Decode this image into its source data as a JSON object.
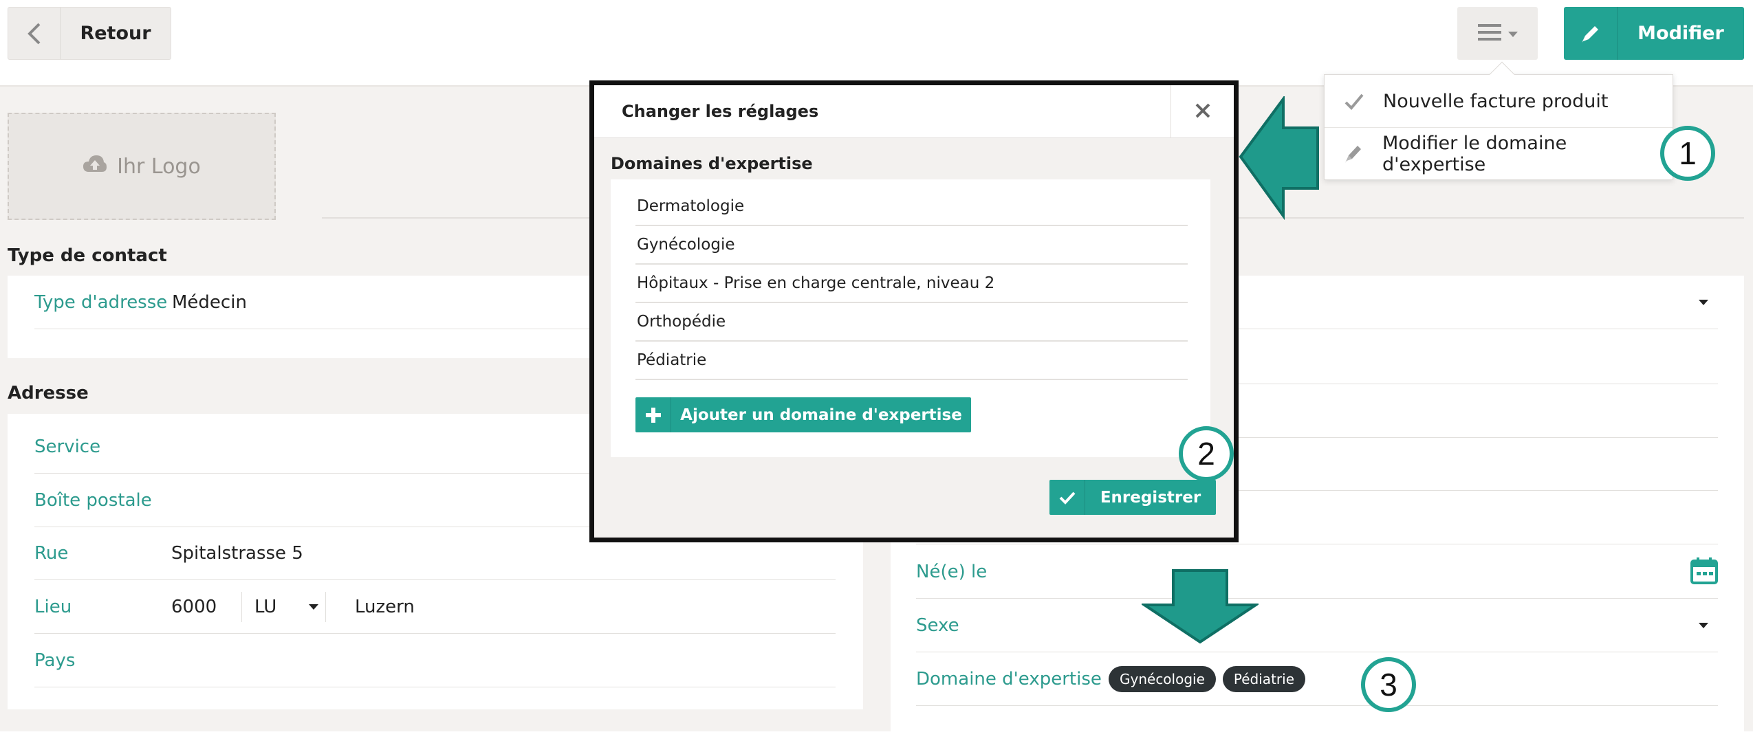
{
  "toolbar": {
    "back_label": "Retour",
    "edit_label": "Modifier"
  },
  "menu": {
    "items": [
      {
        "label": "Nouvelle facture produit",
        "icon": "check-icon"
      },
      {
        "label": "Modifier le domaine d'expertise",
        "icon": "pencil-icon"
      }
    ]
  },
  "logo": {
    "label": "Ihr Logo"
  },
  "contact": {
    "title": "Type de contact",
    "type_label": "Type d'adresse",
    "type_value": "Médecin"
  },
  "address": {
    "title": "Adresse",
    "service_label": "Service",
    "box_label": "Boîte postale",
    "street_label": "Rue",
    "street_value": "Spitalstrasse 5",
    "city_label": "Lieu",
    "zip_value": "6000",
    "canton_value": "LU",
    "city_value": "Luzern",
    "country_label": "Pays"
  },
  "person": {
    "born_label": "Né(e) le",
    "sex_label": "Sexe",
    "expertise_label": "Domaine d'expertise",
    "expertise_tags": [
      "Gynécologie",
      "Pédiatrie"
    ]
  },
  "modal": {
    "title": "Changer les réglages",
    "subtitle": "Domaines d'expertise",
    "items": [
      "Dermatologie",
      "Gynécologie",
      "Hôpitaux - Prise en charge centrale, niveau 2",
      "Orthopédie",
      "Pédiatrie"
    ],
    "add_label": "Ajouter un domaine d'expertise",
    "save_label": "Enregistrer"
  },
  "annotations": {
    "step1": "1",
    "step2": "2",
    "step3": "3"
  },
  "colors": {
    "accent": "#22a393",
    "tag_bg": "#2d3336",
    "label_teal": "#2d9b8e"
  }
}
